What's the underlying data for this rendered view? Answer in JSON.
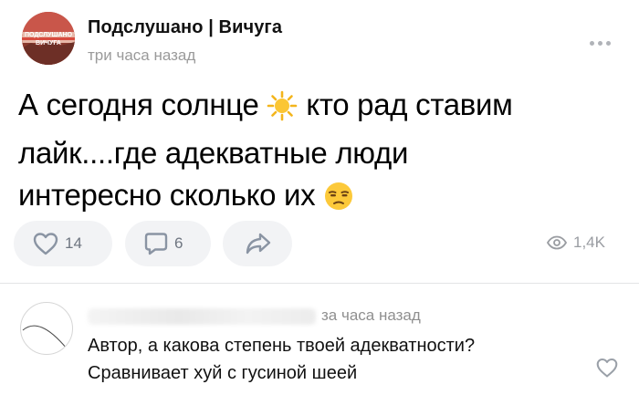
{
  "post": {
    "group_name": "Подслушано | Вичуга",
    "time": "три часа назад",
    "avatar_text": "ПОДСЛУШАНО ВИЧУГА",
    "text_line1_a": "А сегодня солнце",
    "text_line1_b": "кто рад ставим",
    "text_line2": "лайк....где адекватные люди",
    "text_line3": "интересно сколько их",
    "emoji_sun": "sun-emoji",
    "emoji_face": "unamused-face-emoji"
  },
  "actions": {
    "likes": "14",
    "comments": "6",
    "views": "1,4K"
  },
  "comment": {
    "time": "за часа назад",
    "line1": "Автор, а какова степень твоей адекватности?",
    "line2": "Сравнивает хуй с гусиной шеей"
  },
  "colors": {
    "pill_bg": "#f2f3f5",
    "icon": "#8a94a3",
    "muted_text": "#9a9a9a"
  }
}
